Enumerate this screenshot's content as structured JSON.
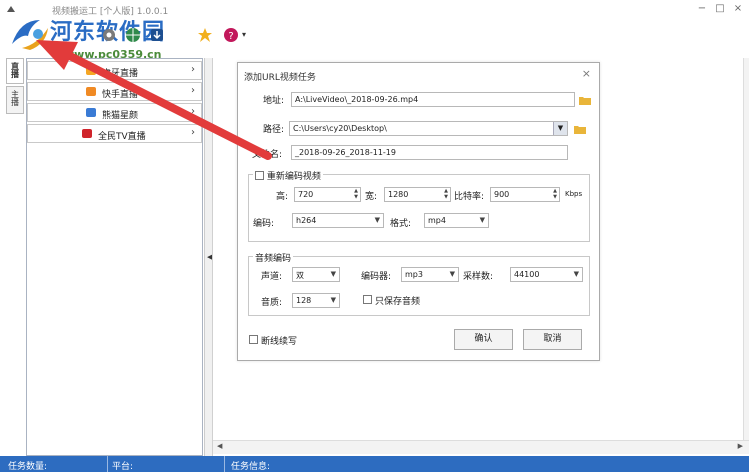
{
  "window": {
    "title": "视频搬运工 [个人版] 1.0.0.1",
    "controls": {
      "minimize": "−",
      "maximize": "□",
      "close": "×"
    }
  },
  "watermark": {
    "title": "河东软件园",
    "url": "www.pc0359.cn"
  },
  "toolbar": {
    "icons": [
      "settings-icon",
      "globe-icon",
      "download-icon",
      "star-icon",
      "help-icon"
    ],
    "help_dropdown": "▾"
  },
  "side_tabs": [
    {
      "label": "直播"
    },
    {
      "label": "主播"
    }
  ],
  "platforms": [
    {
      "label": "虎牙直播",
      "icon": "huya-icon",
      "color": "#f5a623"
    },
    {
      "label": "快手直播",
      "icon": "kuaishou-icon",
      "color": "#f08a24"
    },
    {
      "label": "熊猫星颜",
      "icon": "panda-icon",
      "color": "#3a7bd5"
    },
    {
      "label": "全民TV直播",
      "icon": "quanmin-icon",
      "color": "#d0242b"
    }
  ],
  "dialog": {
    "title": "添加URL视频任务",
    "close": "×",
    "address_label": "地址:",
    "address_value": "A:\\LiveVideo\\_2018-09-26.mp4",
    "path_label": "路径:",
    "path_value": "C:\\Users\\cy20\\Desktop\\",
    "filename_label": "文件名:",
    "filename_value": "_2018-09-26_2018-11-19",
    "reencode": {
      "checkbox_label": "重新编码视频",
      "checked": false,
      "height_label": "高:",
      "height_value": "720",
      "width_label": "宽:",
      "width_value": "1280",
      "bitrate_label": "比特率:",
      "bitrate_value": "900",
      "bitrate_unit": "Kbps",
      "codec_label": "编码:",
      "codec_value": "h264",
      "format_label": "格式:",
      "format_value": "mp4"
    },
    "audio": {
      "group_label": "音频编码",
      "channel_label": "声道:",
      "channel_value": "双",
      "encoder_label": "编码器:",
      "encoder_value": "mp3",
      "samplerate_label": "采样数:",
      "samplerate_value": "44100",
      "quality_label": "音质:",
      "quality_value": "128",
      "audio_only_label": "只保存音频",
      "audio_only_checked": false
    },
    "resume_label": "断线续写",
    "resume_checked": false,
    "ok_label": "确认",
    "cancel_label": "取消"
  },
  "statusbar": {
    "task_count_label": "任务数量:",
    "platform_label": "平台:",
    "task_info_label": "任务信息:"
  },
  "colors": {
    "accent": "#2d6cc0",
    "annotation_arrow": "#e23b3b"
  }
}
